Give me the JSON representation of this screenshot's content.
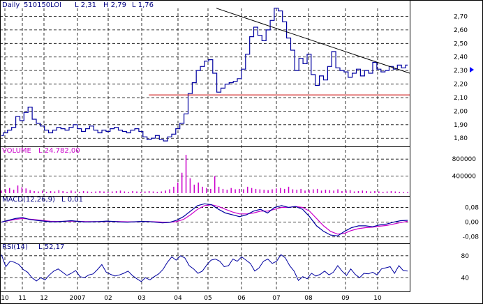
{
  "header": {
    "period": "Daily",
    "symbol": "510150",
    "series_field": "LOI",
    "low": "L 2,31",
    "high": "H 2,79",
    "low2": "L 1,76"
  },
  "colors": {
    "price": "#0000a0",
    "volume": "#cc00cc",
    "macd": "#0000a0",
    "signal": "#cc00cc",
    "rsi": "#0000a0",
    "trendline": "#000000",
    "support": "#cc0000",
    "grid": "#000000",
    "arrow": "#0000ff"
  },
  "chart_data": [
    {
      "panel": "price",
      "type": "line",
      "ylim": [
        1.76,
        2.79
      ],
      "yticks": [
        "2,70",
        "2,60",
        "2,50",
        "2,40",
        "2,30",
        "2,20",
        "2,10",
        "2,00",
        "1,90",
        "1,80"
      ],
      "ytick_values": [
        2.7,
        2.6,
        2.5,
        2.4,
        2.3,
        2.2,
        2.1,
        2.0,
        1.9,
        1.8
      ],
      "grid": true,
      "x_month_index": [
        0,
        1,
        2,
        3,
        4,
        5,
        6,
        7,
        8,
        9,
        10,
        11,
        12,
        13
      ],
      "series": [
        {
          "values": [
            1.82,
            1.84,
            1.86,
            1.88,
            1.96,
            1.93,
            1.99,
            2.03,
            1.94,
            1.91,
            1.89,
            1.86,
            1.84,
            1.86,
            1.88,
            1.87,
            1.86,
            1.88,
            1.9,
            1.87,
            1.85,
            1.87,
            1.89,
            1.86,
            1.84,
            1.86,
            1.85,
            1.87,
            1.88,
            1.86,
            1.85,
            1.84,
            1.86,
            1.87,
            1.85,
            1.81,
            1.79,
            1.8,
            1.82,
            1.79,
            1.78,
            1.81,
            1.83,
            1.87,
            1.91,
            1.98,
            2.13,
            2.21,
            2.3,
            2.33,
            2.37,
            2.38,
            2.28,
            2.14,
            2.17,
            2.2,
            2.21,
            2.22,
            2.24,
            2.31,
            2.42,
            2.55,
            2.62,
            2.56,
            2.52,
            2.6,
            2.67,
            2.76,
            2.74,
            2.66,
            2.54,
            2.45,
            2.3,
            2.39,
            2.35,
            2.42,
            2.27,
            2.19,
            2.26,
            2.23,
            2.33,
            2.44,
            2.32,
            2.3,
            2.29,
            2.25,
            2.28,
            2.31,
            2.26,
            2.3,
            2.28,
            2.36,
            2.31,
            2.29,
            2.3,
            2.33,
            2.31,
            2.34,
            2.32,
            2.34
          ]
        }
      ],
      "annotations": [
        {
          "kind": "trendline",
          "from": [
            7.25,
            2.76
          ],
          "to": [
            11.85,
            2.28
          ]
        },
        {
          "kind": "support",
          "from": [
            5.2,
            2.12
          ],
          "to": [
            11.85,
            2.12
          ]
        }
      ]
    },
    {
      "panel": "volume",
      "type": "bar",
      "label": "VOLUME",
      "value_label": "L  24.782,00",
      "ylim": [
        0,
        1000000
      ],
      "yticks": [
        "800000",
        "400000"
      ],
      "ytick_values": [
        800000,
        400000
      ],
      "values": [
        60000,
        90000,
        120000,
        80000,
        180000,
        140000,
        110000,
        70000,
        50000,
        40000,
        60000,
        30000,
        50000,
        40000,
        70000,
        50000,
        30000,
        60000,
        40000,
        30000,
        50000,
        40000,
        30000,
        40000,
        50000,
        40000,
        30000,
        40000,
        50000,
        60000,
        40000,
        30000,
        50000,
        40000,
        30000,
        40000,
        50000,
        40000,
        30000,
        40000,
        60000,
        90000,
        150000,
        250000,
        480000,
        900000,
        350000,
        200000,
        250000,
        150000,
        120000,
        100000,
        400000,
        150000,
        100000,
        80000,
        120000,
        90000,
        100000,
        90000,
        150000,
        120000,
        100000,
        90000,
        80000,
        70000,
        90000,
        110000,
        120000,
        100000,
        150000,
        90000,
        80000,
        100000,
        60000,
        70000,
        90000,
        100000,
        60000,
        80000,
        70000,
        60000,
        90000,
        50000,
        60000,
        70000,
        40000,
        50000,
        60000,
        50000,
        40000,
        50000,
        40000,
        30000,
        40000,
        50000,
        40000,
        30000,
        25000,
        24782
      ]
    },
    {
      "panel": "macd",
      "type": "line",
      "label": "MACD(12,26,9)",
      "value_label": "L  0,01",
      "ylim": [
        -0.1,
        0.12
      ],
      "yticks": [
        "0,08",
        "0,00",
        "-0,08"
      ],
      "ytick_values": [
        0.08,
        0.0,
        -0.08
      ],
      "series": [
        {
          "values": [
            0.0,
            0.01,
            0.02,
            0.025,
            0.015,
            0.01,
            0.006,
            0.002,
            0.002,
            0.005,
            0.008,
            0.004,
            0.001,
            0.002,
            0.003,
            0.006,
            0.004,
            0.001,
            0.0,
            0.002,
            0.004,
            0.003,
            0.0,
            -0.004,
            -0.001,
            0.01,
            0.03,
            0.06,
            0.09,
            0.1,
            0.095,
            0.07,
            0.05,
            0.04,
            0.03,
            0.04,
            0.06,
            0.07,
            0.05,
            0.08,
            0.09,
            0.08,
            0.085,
            0.07,
            0.03,
            -0.02,
            -0.05,
            -0.07,
            -0.075,
            -0.05,
            -0.03,
            -0.02,
            -0.02,
            -0.025,
            -0.015,
            -0.01,
            0.0,
            0.008,
            0.01
          ]
        },
        {
          "values": [
            0.0,
            0.008,
            0.015,
            0.02,
            0.017,
            0.013,
            0.009,
            0.005,
            0.004,
            0.005,
            0.006,
            0.005,
            0.003,
            0.003,
            0.003,
            0.004,
            0.004,
            0.003,
            0.002,
            0.002,
            0.003,
            0.003,
            0.002,
            0.0,
            -0.001,
            0.003,
            0.015,
            0.04,
            0.07,
            0.09,
            0.095,
            0.085,
            0.07,
            0.055,
            0.045,
            0.045,
            0.05,
            0.06,
            0.06,
            0.07,
            0.08,
            0.08,
            0.085,
            0.08,
            0.06,
            0.02,
            -0.02,
            -0.05,
            -0.065,
            -0.06,
            -0.045,
            -0.035,
            -0.03,
            -0.027,
            -0.022,
            -0.018,
            -0.01,
            -0.002,
            0.005
          ]
        }
      ]
    },
    {
      "panel": "rsi",
      "type": "line",
      "label": "RSI(14)",
      "value_label": "L  52,17",
      "ylim": [
        20,
        95
      ],
      "yticks": [
        "80",
        "40"
      ],
      "ytick_values": [
        80,
        40
      ],
      "series": [
        {
          "values": [
            82,
            60,
            70,
            68,
            64,
            55,
            50,
            40,
            34,
            40,
            36,
            45,
            52,
            56,
            50,
            44,
            48,
            53,
            42,
            40,
            45,
            47,
            55,
            64,
            50,
            46,
            43,
            45,
            48,
            52,
            44,
            38,
            33,
            40,
            36,
            42,
            47,
            55,
            68,
            78,
            72,
            80,
            76,
            62,
            56,
            48,
            52,
            63,
            72,
            74,
            70,
            60,
            62,
            74,
            70,
            78,
            72,
            66,
            52,
            58,
            70,
            74,
            66,
            70,
            82,
            76,
            62,
            52,
            35,
            42,
            38,
            48,
            43,
            46,
            52,
            45,
            50,
            62,
            52,
            44,
            56,
            46,
            40,
            48,
            47,
            50,
            45,
            56,
            58,
            60,
            48,
            62,
            53,
            52
          ]
        }
      ]
    }
  ],
  "x_axis": {
    "labels": [
      "10",
      "11",
      "12",
      "2007",
      "02",
      "03",
      "04",
      "05",
      "06",
      "07",
      "08",
      "09",
      "10"
    ],
    "label_positions": [
      0,
      1,
      2,
      3,
      4,
      5,
      6,
      7,
      8,
      9,
      10,
      11,
      12
    ]
  }
}
